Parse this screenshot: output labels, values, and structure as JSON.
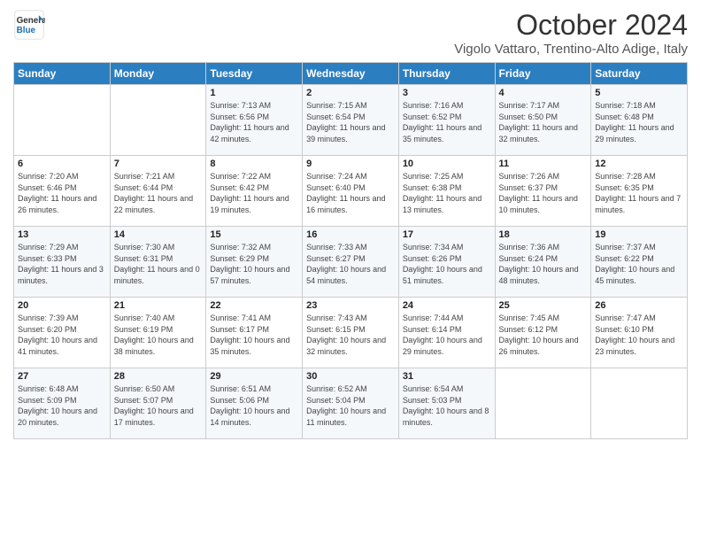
{
  "header": {
    "logo_line1": "General",
    "logo_line2": "Blue",
    "month": "October 2024",
    "location": "Vigolo Vattaro, Trentino-Alto Adige, Italy"
  },
  "weekdays": [
    "Sunday",
    "Monday",
    "Tuesday",
    "Wednesday",
    "Thursday",
    "Friday",
    "Saturday"
  ],
  "weeks": [
    [
      {
        "day": "",
        "info": ""
      },
      {
        "day": "",
        "info": ""
      },
      {
        "day": "1",
        "info": "Sunrise: 7:13 AM\nSunset: 6:56 PM\nDaylight: 11 hours and 42 minutes."
      },
      {
        "day": "2",
        "info": "Sunrise: 7:15 AM\nSunset: 6:54 PM\nDaylight: 11 hours and 39 minutes."
      },
      {
        "day": "3",
        "info": "Sunrise: 7:16 AM\nSunset: 6:52 PM\nDaylight: 11 hours and 35 minutes."
      },
      {
        "day": "4",
        "info": "Sunrise: 7:17 AM\nSunset: 6:50 PM\nDaylight: 11 hours and 32 minutes."
      },
      {
        "day": "5",
        "info": "Sunrise: 7:18 AM\nSunset: 6:48 PM\nDaylight: 11 hours and 29 minutes."
      }
    ],
    [
      {
        "day": "6",
        "info": "Sunrise: 7:20 AM\nSunset: 6:46 PM\nDaylight: 11 hours and 26 minutes."
      },
      {
        "day": "7",
        "info": "Sunrise: 7:21 AM\nSunset: 6:44 PM\nDaylight: 11 hours and 22 minutes."
      },
      {
        "day": "8",
        "info": "Sunrise: 7:22 AM\nSunset: 6:42 PM\nDaylight: 11 hours and 19 minutes."
      },
      {
        "day": "9",
        "info": "Sunrise: 7:24 AM\nSunset: 6:40 PM\nDaylight: 11 hours and 16 minutes."
      },
      {
        "day": "10",
        "info": "Sunrise: 7:25 AM\nSunset: 6:38 PM\nDaylight: 11 hours and 13 minutes."
      },
      {
        "day": "11",
        "info": "Sunrise: 7:26 AM\nSunset: 6:37 PM\nDaylight: 11 hours and 10 minutes."
      },
      {
        "day": "12",
        "info": "Sunrise: 7:28 AM\nSunset: 6:35 PM\nDaylight: 11 hours and 7 minutes."
      }
    ],
    [
      {
        "day": "13",
        "info": "Sunrise: 7:29 AM\nSunset: 6:33 PM\nDaylight: 11 hours and 3 minutes."
      },
      {
        "day": "14",
        "info": "Sunrise: 7:30 AM\nSunset: 6:31 PM\nDaylight: 11 hours and 0 minutes."
      },
      {
        "day": "15",
        "info": "Sunrise: 7:32 AM\nSunset: 6:29 PM\nDaylight: 10 hours and 57 minutes."
      },
      {
        "day": "16",
        "info": "Sunrise: 7:33 AM\nSunset: 6:27 PM\nDaylight: 10 hours and 54 minutes."
      },
      {
        "day": "17",
        "info": "Sunrise: 7:34 AM\nSunset: 6:26 PM\nDaylight: 10 hours and 51 minutes."
      },
      {
        "day": "18",
        "info": "Sunrise: 7:36 AM\nSunset: 6:24 PM\nDaylight: 10 hours and 48 minutes."
      },
      {
        "day": "19",
        "info": "Sunrise: 7:37 AM\nSunset: 6:22 PM\nDaylight: 10 hours and 45 minutes."
      }
    ],
    [
      {
        "day": "20",
        "info": "Sunrise: 7:39 AM\nSunset: 6:20 PM\nDaylight: 10 hours and 41 minutes."
      },
      {
        "day": "21",
        "info": "Sunrise: 7:40 AM\nSunset: 6:19 PM\nDaylight: 10 hours and 38 minutes."
      },
      {
        "day": "22",
        "info": "Sunrise: 7:41 AM\nSunset: 6:17 PM\nDaylight: 10 hours and 35 minutes."
      },
      {
        "day": "23",
        "info": "Sunrise: 7:43 AM\nSunset: 6:15 PM\nDaylight: 10 hours and 32 minutes."
      },
      {
        "day": "24",
        "info": "Sunrise: 7:44 AM\nSunset: 6:14 PM\nDaylight: 10 hours and 29 minutes."
      },
      {
        "day": "25",
        "info": "Sunrise: 7:45 AM\nSunset: 6:12 PM\nDaylight: 10 hours and 26 minutes."
      },
      {
        "day": "26",
        "info": "Sunrise: 7:47 AM\nSunset: 6:10 PM\nDaylight: 10 hours and 23 minutes."
      }
    ],
    [
      {
        "day": "27",
        "info": "Sunrise: 6:48 AM\nSunset: 5:09 PM\nDaylight: 10 hours and 20 minutes."
      },
      {
        "day": "28",
        "info": "Sunrise: 6:50 AM\nSunset: 5:07 PM\nDaylight: 10 hours and 17 minutes."
      },
      {
        "day": "29",
        "info": "Sunrise: 6:51 AM\nSunset: 5:06 PM\nDaylight: 10 hours and 14 minutes."
      },
      {
        "day": "30",
        "info": "Sunrise: 6:52 AM\nSunset: 5:04 PM\nDaylight: 10 hours and 11 minutes."
      },
      {
        "day": "31",
        "info": "Sunrise: 6:54 AM\nSunset: 5:03 PM\nDaylight: 10 hours and 8 minutes."
      },
      {
        "day": "",
        "info": ""
      },
      {
        "day": "",
        "info": ""
      }
    ]
  ]
}
